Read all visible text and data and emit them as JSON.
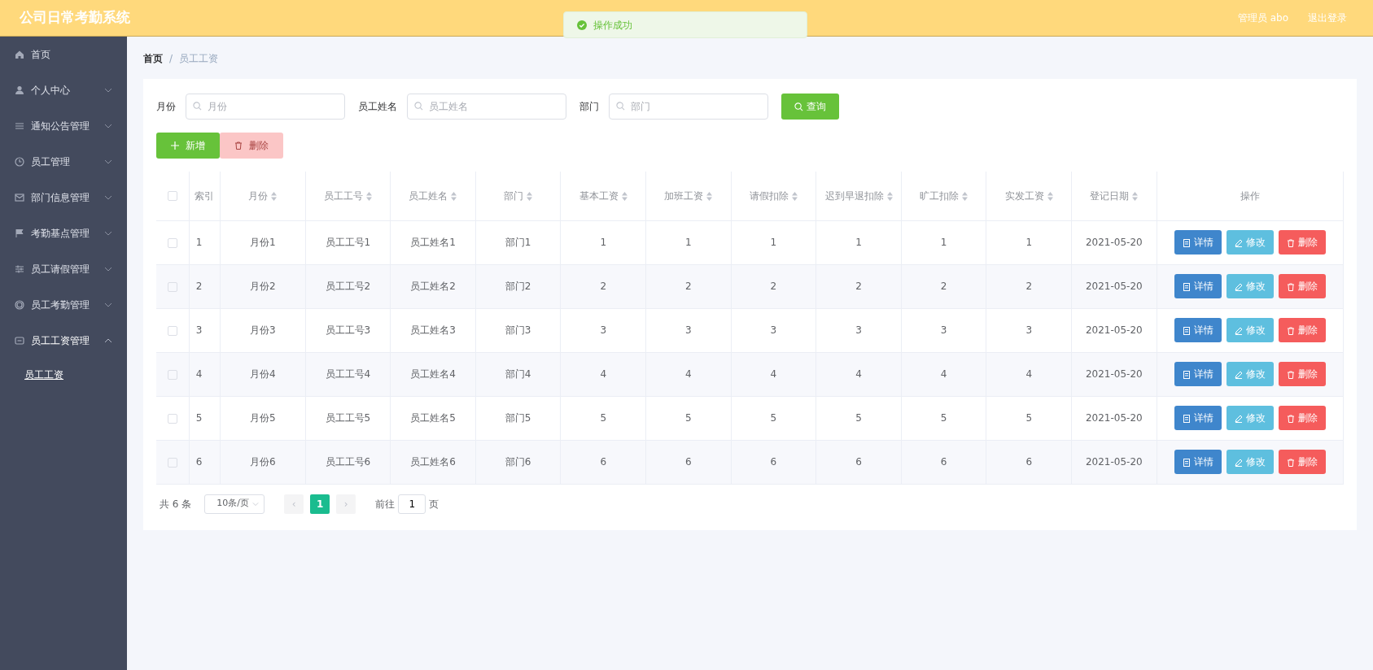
{
  "header": {
    "title": "公司日常考勤系统",
    "user": "管理员 abo",
    "logout": "退出登录"
  },
  "toast": {
    "message": "操作成功"
  },
  "sidebar": {
    "items": [
      {
        "label": "首页",
        "has_menu": false,
        "expanded": false
      },
      {
        "label": "个人中心",
        "has_menu": true,
        "expanded": false
      },
      {
        "label": "通知公告管理",
        "has_menu": true,
        "expanded": false
      },
      {
        "label": "员工管理",
        "has_menu": true,
        "expanded": false
      },
      {
        "label": "部门信息管理",
        "has_menu": true,
        "expanded": false
      },
      {
        "label": "考勤基点管理",
        "has_menu": true,
        "expanded": false
      },
      {
        "label": "员工请假管理",
        "has_menu": true,
        "expanded": false
      },
      {
        "label": "员工考勤管理",
        "has_menu": true,
        "expanded": false
      },
      {
        "label": "员工工资管理",
        "has_menu": true,
        "expanded": true,
        "children": [
          {
            "label": "员工工资",
            "selected": true
          }
        ]
      }
    ]
  },
  "breadcrumb": {
    "items": [
      "首页",
      "员工工资"
    ],
    "separator": "/"
  },
  "filters": [
    {
      "label": "月份",
      "placeholder": "月份"
    },
    {
      "label": "员工姓名",
      "placeholder": "员工姓名"
    },
    {
      "label": "部门",
      "placeholder": "部门"
    }
  ],
  "search_button": "查询",
  "toolbar": [
    {
      "label": "新增",
      "kind": "add",
      "disabled": false
    },
    {
      "label": "删除",
      "kind": "delete",
      "disabled": true
    }
  ],
  "table": {
    "select_all_checked": false,
    "columns": [
      {
        "label": "索引",
        "sortable": false
      },
      {
        "label": "月份",
        "sortable": true
      },
      {
        "label": "员工工号",
        "sortable": true
      },
      {
        "label": "员工姓名",
        "sortable": true
      },
      {
        "label": "部门",
        "sortable": true
      },
      {
        "label": "基本工资",
        "sortable": true
      },
      {
        "label": "加班工资",
        "sortable": true
      },
      {
        "label": "请假扣除",
        "sortable": true
      },
      {
        "label": "迟到早退扣除",
        "sortable": true
      },
      {
        "label": "旷工扣除",
        "sortable": true
      },
      {
        "label": "实发工资",
        "sortable": true
      },
      {
        "label": "登记日期",
        "sortable": true
      },
      {
        "label": "操作",
        "sortable": false
      }
    ],
    "rows": [
      {
        "checked": false,
        "cells": [
          "1",
          "月份1",
          "员工工号1",
          "员工姓名1",
          "部门1",
          "1",
          "1",
          "1",
          "1",
          "1",
          "1",
          "2021-05-20"
        ],
        "actions": [
          {
            "label": "详情",
            "kind": "detail"
          },
          {
            "label": "修改",
            "kind": "edit"
          },
          {
            "label": "删除",
            "kind": "delete"
          }
        ]
      },
      {
        "checked": false,
        "cells": [
          "2",
          "月份2",
          "员工工号2",
          "员工姓名2",
          "部门2",
          "2",
          "2",
          "2",
          "2",
          "2",
          "2",
          "2021-05-20"
        ],
        "actions": [
          {
            "label": "详情",
            "kind": "detail"
          },
          {
            "label": "修改",
            "kind": "edit"
          },
          {
            "label": "删除",
            "kind": "delete"
          }
        ]
      },
      {
        "checked": false,
        "cells": [
          "3",
          "月份3",
          "员工工号3",
          "员工姓名3",
          "部门3",
          "3",
          "3",
          "3",
          "3",
          "3",
          "3",
          "2021-05-20"
        ],
        "actions": [
          {
            "label": "详情",
            "kind": "detail"
          },
          {
            "label": "修改",
            "kind": "edit"
          },
          {
            "label": "删除",
            "kind": "delete"
          }
        ]
      },
      {
        "checked": false,
        "cells": [
          "4",
          "月份4",
          "员工工号4",
          "员工姓名4",
          "部门4",
          "4",
          "4",
          "4",
          "4",
          "4",
          "4",
          "2021-05-20"
        ],
        "actions": [
          {
            "label": "详情",
            "kind": "detail"
          },
          {
            "label": "修改",
            "kind": "edit"
          },
          {
            "label": "删除",
            "kind": "delete"
          }
        ]
      },
      {
        "checked": false,
        "cells": [
          "5",
          "月份5",
          "员工工号5",
          "员工姓名5",
          "部门5",
          "5",
          "5",
          "5",
          "5",
          "5",
          "5",
          "2021-05-20"
        ],
        "actions": [
          {
            "label": "详情",
            "kind": "detail"
          },
          {
            "label": "修改",
            "kind": "edit"
          },
          {
            "label": "删除",
            "kind": "delete"
          }
        ]
      },
      {
        "checked": false,
        "cells": [
          "6",
          "月份6",
          "员工工号6",
          "员工姓名6",
          "部门6",
          "6",
          "6",
          "6",
          "6",
          "6",
          "6",
          "2021-05-20"
        ],
        "actions": [
          {
            "label": "详情",
            "kind": "detail"
          },
          {
            "label": "修改",
            "kind": "edit"
          },
          {
            "label": "删除",
            "kind": "delete"
          }
        ]
      }
    ]
  },
  "pagination": {
    "total": "共 6 条",
    "page_size": "10条/页",
    "prev": "‹",
    "pages": [
      {
        "label": "1",
        "selected": true
      }
    ],
    "next": "›",
    "goto_label": "前往",
    "goto_value": "1",
    "goto_suffix": "页"
  }
}
